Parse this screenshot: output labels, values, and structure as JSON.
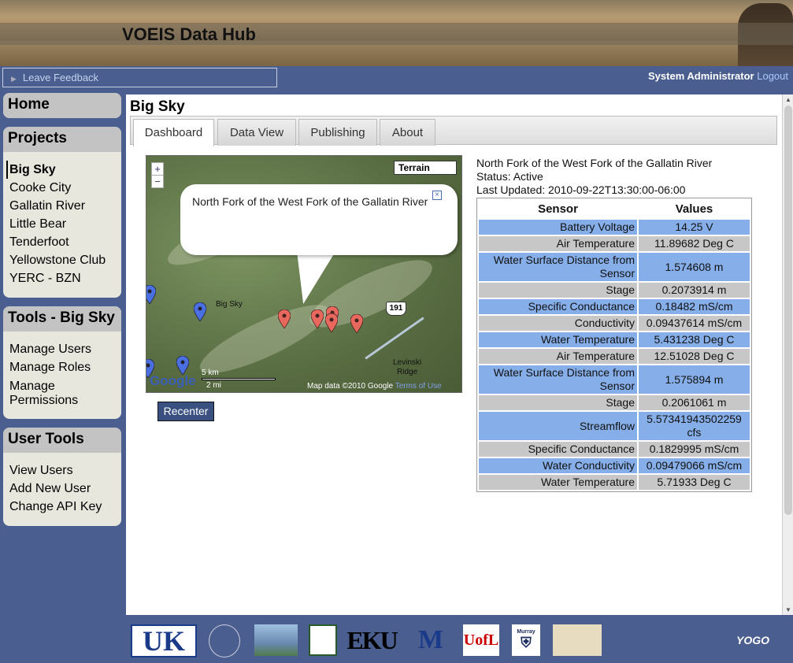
{
  "header": {
    "title": "VOEIS Data Hub"
  },
  "topbar": {
    "feedback": "Leave Feedback",
    "user": "System Administrator",
    "logout": "Logout"
  },
  "sidebar": {
    "home": "Home",
    "projects": {
      "title": "Projects",
      "items": [
        "Big Sky",
        "Cooke City",
        "Gallatin River",
        "Little Bear",
        "Tenderfoot",
        "Yellowstone Club",
        "YERC - BZN"
      ]
    },
    "tools": {
      "title": "Tools - Big Sky",
      "items": [
        "Manage Users",
        "Manage Roles",
        "Manage Permissions"
      ]
    },
    "usertools": {
      "title": "User Tools",
      "items": [
        "View Users",
        "Add New User",
        "Change API Key"
      ]
    }
  },
  "page": {
    "title": "Big Sky",
    "tabs": [
      "Dashboard",
      "Data View",
      "Publishing",
      "About"
    ]
  },
  "map": {
    "bubble": "North Fork of the West Fork of the Gallatin River",
    "terrain": "Terrain",
    "zoom_in": "+",
    "zoom_out": "−",
    "label_bigsky": "Big Sky",
    "label_levinski": "Levinski",
    "label_ridge": "Ridge",
    "highway": "191",
    "scale_km": "5 km",
    "scale_mi": "2 mi",
    "google": "Google",
    "mapdata": "Map data ©2010 Google",
    "terms": "Terms of Use",
    "recenter": "Recenter"
  },
  "site": {
    "name": "North Fork of the West Fork of the Gallatin River",
    "status": "Status: Active",
    "updated": "Last Updated: 2010-09-22T13:30:00-06:00"
  },
  "table": {
    "headers": [
      "Sensor",
      "Values"
    ],
    "rows": [
      {
        "sensor": "Battery Voltage",
        "value": "14.25 V"
      },
      {
        "sensor": "Air Temperature",
        "value": "11.89682 Deg C"
      },
      {
        "sensor": "Water Surface Distance from Sensor",
        "value": "1.574608 m"
      },
      {
        "sensor": "Stage",
        "value": "0.2073914 m"
      },
      {
        "sensor": "Specific Conductance",
        "value": "0.18482 mS/cm"
      },
      {
        "sensor": "Conductivity",
        "value": "0.09437614 mS/cm"
      },
      {
        "sensor": "Water Temperature",
        "value": "5.431238 Deg C"
      },
      {
        "sensor": "Air Temperature",
        "value": "12.51028 Deg C"
      },
      {
        "sensor": "Water Surface Distance from Sensor",
        "value": "1.575894 m"
      },
      {
        "sensor": "Stage",
        "value": "0.2061061 m"
      },
      {
        "sensor": "Streamflow",
        "value": "5.57341943502259 cfs"
      },
      {
        "sensor": "Specific Conductance",
        "value": "0.1829995 mS/cm"
      },
      {
        "sensor": "Water Conductivity",
        "value": "0.09479066 mS/cm"
      },
      {
        "sensor": "Water Temperature",
        "value": "5.71933 Deg C"
      }
    ]
  },
  "footer": {
    "logos": [
      "UK",
      "EKU",
      "M",
      "UofL",
      "Murray",
      "YOGO"
    ],
    "logo_names": [
      "university-of-kentucky-logo",
      "university-of-montana-seal-logo",
      "flathead-lake-biological-station-logo",
      "partner-grid-logo",
      "eastern-kentucky-university-logo",
      "montana-state-university-logo",
      "university-of-louisville-logo",
      "murray-state-logo",
      "yellowstone-ecological-research-center-logo",
      "yogo-logo"
    ]
  }
}
